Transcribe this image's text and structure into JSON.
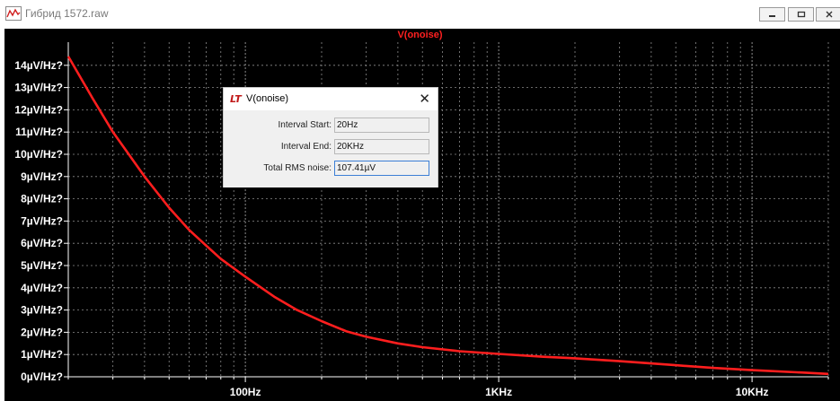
{
  "window": {
    "title": "Гибрид 1572.raw",
    "icon": "waveform-app-icon",
    "buttons": {
      "minimize": "minimize-icon",
      "maximize": "maximize-icon",
      "close": "close-icon"
    }
  },
  "plot": {
    "trace_label": "V(onoise)"
  },
  "dialog": {
    "logo": "LT",
    "title": "V(onoise)",
    "close": "✕",
    "fields": [
      {
        "label": "Interval Start:",
        "value": "20Hz"
      },
      {
        "label": "Interval End:",
        "value": "20KHz"
      },
      {
        "label": "Total RMS noise:",
        "value": "107.41µV"
      }
    ]
  },
  "chart_data": {
    "type": "line",
    "title": "V(onoise)",
    "x_scale": "log",
    "xlim": [
      20,
      20000
    ],
    "ylim": [
      0,
      14.5
    ],
    "x_tick_labels": [
      "100Hz",
      "1KHz",
      "10KHz"
    ],
    "x_ticks": [
      100,
      1000,
      10000
    ],
    "y_tick_labels": [
      "0µV/Hz?",
      "1µV/Hz?",
      "2µV/Hz?",
      "3µV/Hz?",
      "4µV/Hz?",
      "5µV/Hz?",
      "6µV/Hz?",
      "7µV/Hz?",
      "8µV/Hz?",
      "9µV/Hz?",
      "10µV/Hz?",
      "11µV/Hz?",
      "12µV/Hz?",
      "13µV/Hz?",
      "14µV/Hz?"
    ],
    "y_ticks": [
      0,
      1,
      2,
      3,
      4,
      5,
      6,
      7,
      8,
      9,
      10,
      11,
      12,
      13,
      14
    ],
    "grid": true,
    "colors": {
      "background": "#000000",
      "grid": "#8c8c8c",
      "trace": "#ff1e1e",
      "text": "#ffffff"
    },
    "series": [
      {
        "name": "V(onoise)",
        "x": [
          20,
          25,
          30,
          40,
          50,
          60,
          70,
          80,
          100,
          130,
          160,
          200,
          250,
          300,
          400,
          500,
          700,
          1000,
          1500,
          2000,
          3000,
          5000,
          7000,
          10000,
          15000,
          20000
        ],
        "y": [
          14.4,
          12.5,
          11.0,
          9.0,
          7.6,
          6.6,
          5.9,
          5.3,
          4.5,
          3.6,
          3.0,
          2.5,
          2.05,
          1.8,
          1.5,
          1.33,
          1.15,
          1.03,
          0.9,
          0.83,
          0.7,
          0.52,
          0.4,
          0.3,
          0.2,
          0.13
        ]
      }
    ]
  }
}
